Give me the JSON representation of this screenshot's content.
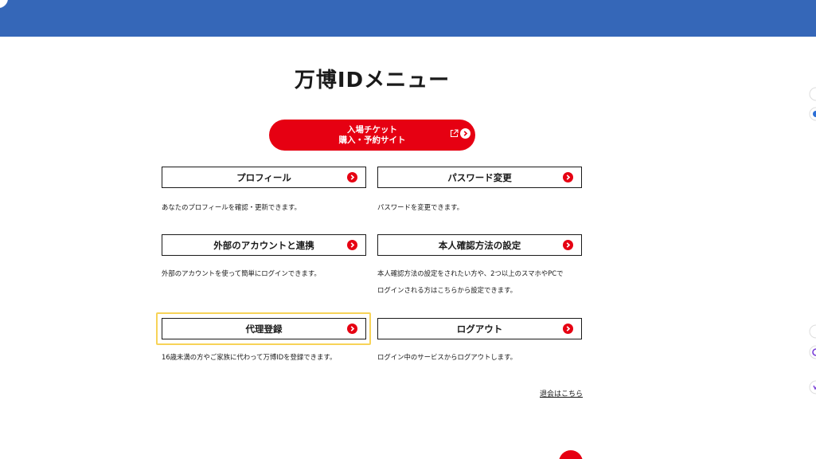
{
  "page": {
    "title": "万博IDメニュー"
  },
  "ticket_button": {
    "line1": "入場チケット",
    "line2": "購入・予約サイト"
  },
  "menu": [
    {
      "label": "プロフィール",
      "description": "あなたのプロフィールを確認・更新できます。"
    },
    {
      "label": "パスワード変更",
      "description": "パスワードを変更できます。"
    },
    {
      "label": "外部のアカウントと連携",
      "description": "外部のアカウントを使って簡単にログインできます。"
    },
    {
      "label": "本人確認方法の設定",
      "description_line1": "本人確認方法の設定をされたい方や、2つ以上のスマホやPCで",
      "description_line2": "ログインされる方はこちらから設定できます。"
    },
    {
      "label": "代理登録",
      "description": "16歳未満の方やご家族に代わって万博IDを登録できます。"
    },
    {
      "label": "ログアウト",
      "description": "ログイン中のサービスからログアウトします。"
    }
  ],
  "withdraw_link": "退会はこちら",
  "colors": {
    "header": "#3567b8",
    "accent_red": "#e60012",
    "focus_yellow": "#f7d358"
  },
  "icons": {
    "external": "external-link-icon",
    "arrow": "chevron-right-circle-icon"
  }
}
